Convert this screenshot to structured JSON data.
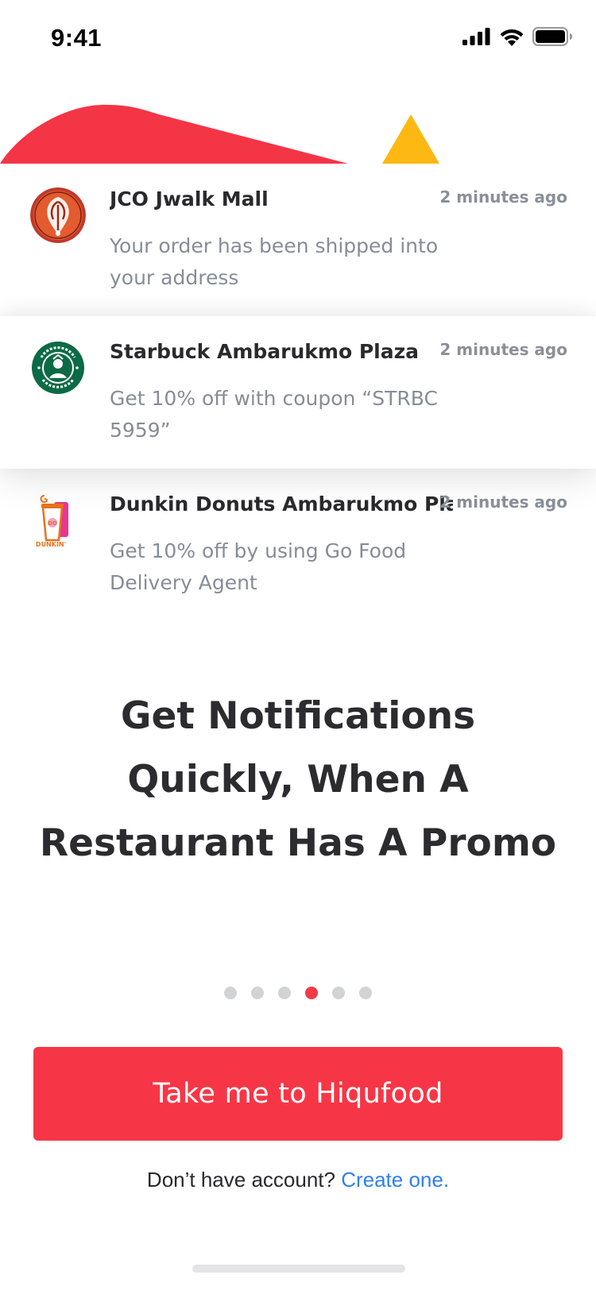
{
  "status_bar": {
    "time": "9:41",
    "icons": [
      "signal-icon",
      "wifi-icon",
      "battery-icon"
    ]
  },
  "notifications": [
    {
      "brand_icon": "jco-logo",
      "title": "JCO Jwalk Mall",
      "time": "2 minutes ago",
      "body": "Your order has been shipped into your address"
    },
    {
      "brand_icon": "starbucks-logo",
      "title": "Starbuck Ambarukmo Plaza",
      "time": "2 minutes ago",
      "body": "Get 10% off with coupon “STRBC 5959”"
    },
    {
      "brand_icon": "dunkin-logo",
      "title": "Dunkin Donuts Ambarukmo Plaza",
      "time": "2 minutes ago",
      "body": "Get 10% off by using Go Food Delivery Agent"
    }
  ],
  "headline": "Get Notifications Quickly, When A Restaurant Has A Promo",
  "pager": {
    "total": 6,
    "active_index": 3
  },
  "cta": {
    "label": "Take me to Hiqufood"
  },
  "signup": {
    "prompt": "Don’t have account?",
    "link": "Create one."
  },
  "colors": {
    "accent": "#f63646",
    "deco_red": "#f43546",
    "deco_yellow": "#fdb813",
    "link": "#2f80ed",
    "dot_inactive": "#d2d3d6"
  }
}
